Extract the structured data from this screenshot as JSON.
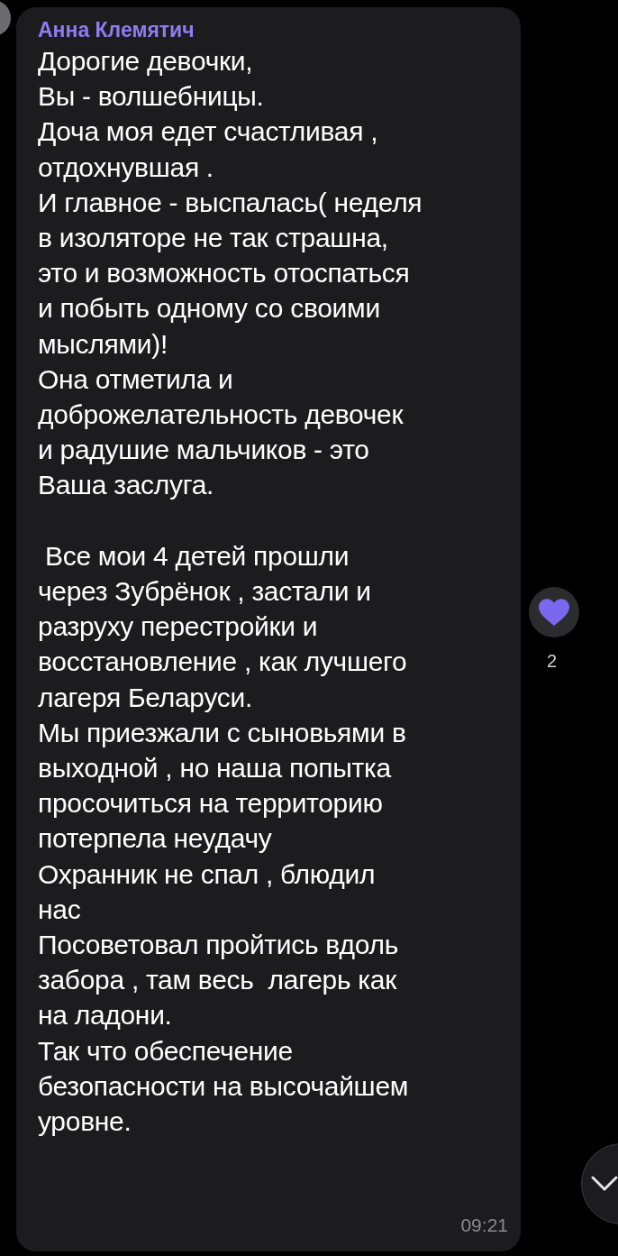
{
  "message": {
    "sender": "Анна Клемятич",
    "text": "Дорогие девочки,\nВы - волшебницы.\nДоча моя едет счастливая ,\nотдохнувшая .\nИ главное - выспалась( неделя\nв изоляторе не так страшна,\nэто и возможность отоспаться\nи побыть одному со своими\nмыслями)!\nОна отметила и\nдоброжелательность девочек\nи радушие мальчиков - это\nВаша заслуга.\n\n Все мои 4 детей прошли\nчерез Зубрёнок , застали и\nразруху перестройки и\nвосстановление , как лучшего\nлагеря Беларуси.\nМы приезжали с сыновьями в\nвыходной , но наша попытка\nпросочиться на территорию\nпотерпела неудачу\nОхранник не спал , блюдил\nнас\nПосоветовал пройтись вдоль\nзабора , там весь  лагерь как\nна ладони.\nТак что обеспечение\nбезопасности на высочайшем\nуровне.",
    "time": "09:21"
  },
  "reaction": {
    "count": "2"
  }
}
